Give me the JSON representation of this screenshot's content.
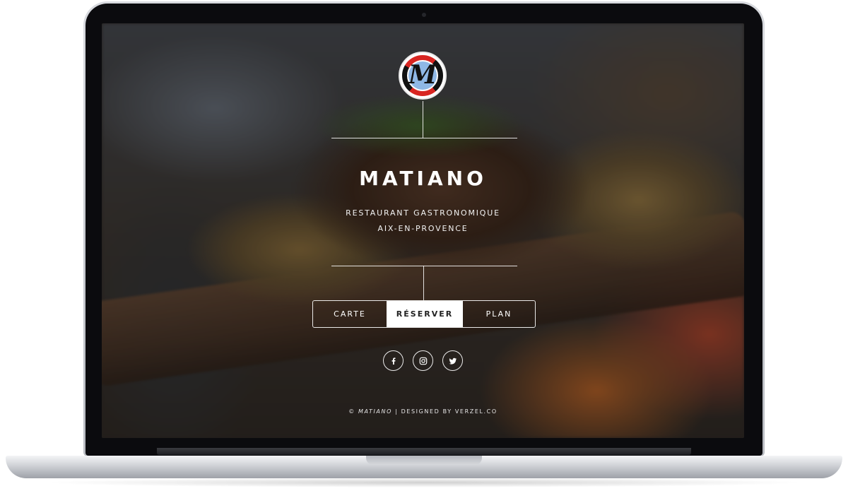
{
  "site": {
    "logo_letter": "M",
    "title": "MATIANO",
    "subtitle_line1": "RESTAURANT GASTRONOMIQUE",
    "subtitle_line2": "AIX-EN-PROVENCE"
  },
  "nav": {
    "items": [
      {
        "label": "CARTE",
        "active": false
      },
      {
        "label": "RÉSERVER",
        "active": true
      },
      {
        "label": "PLAN",
        "active": false
      }
    ]
  },
  "social": {
    "icons": [
      "facebook-icon",
      "instagram-icon",
      "twitter-icon"
    ]
  },
  "footer": {
    "copyright": "©",
    "brand": "MATIANO",
    "credit": "| DESIGNED BY VERZEL.CO"
  },
  "colors": {
    "logo_red": "#d82521",
    "logo_blue": "#8fb8e6",
    "text": "#ffffff",
    "active_button_bg": "#ffffff"
  }
}
